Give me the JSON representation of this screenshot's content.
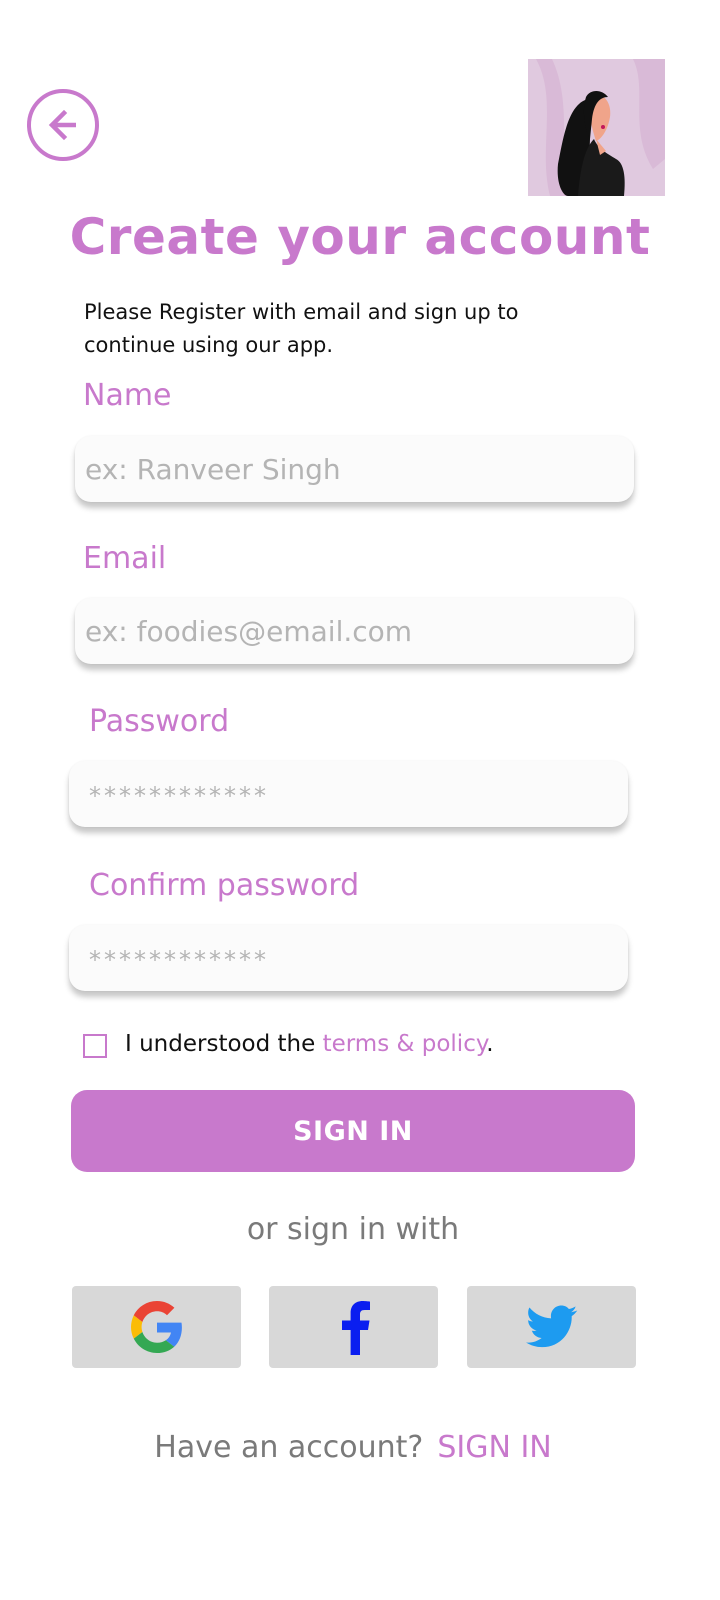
{
  "header": {
    "back_icon": "arrow-left-circle-icon",
    "avatar_icon": "woman-illustration"
  },
  "page": {
    "title": "Create your account",
    "subtitle": "Please Register with email and sign up to continue using our app."
  },
  "form": {
    "name": {
      "label": "Name",
      "placeholder": "ex: Ranveer Singh",
      "value": ""
    },
    "email": {
      "label": "Email",
      "placeholder": "ex: foodies@email.com",
      "value": ""
    },
    "password": {
      "label": "Password",
      "placeholder": "************",
      "value": ""
    },
    "confirm_password": {
      "label": "Confirm password",
      "placeholder": "************",
      "value": ""
    }
  },
  "terms": {
    "checked": false,
    "prefix": "I understood the ",
    "link": "terms & policy",
    "suffix": "."
  },
  "actions": {
    "sign_in_button": "SIGN IN",
    "or_text": "or sign in with"
  },
  "social": [
    {
      "name": "Google",
      "icon": "google-icon"
    },
    {
      "name": "Facebook",
      "icon": "facebook-icon"
    },
    {
      "name": "Twitter",
      "icon": "twitter-icon"
    }
  ],
  "footer": {
    "question": "Have an account?",
    "link": "SIGN IN"
  },
  "colors": {
    "accent": "#c879cc",
    "field_bg": "#fbfbfb",
    "social_bg": "#d8d8d8",
    "muted_text": "#7a7a7a"
  }
}
